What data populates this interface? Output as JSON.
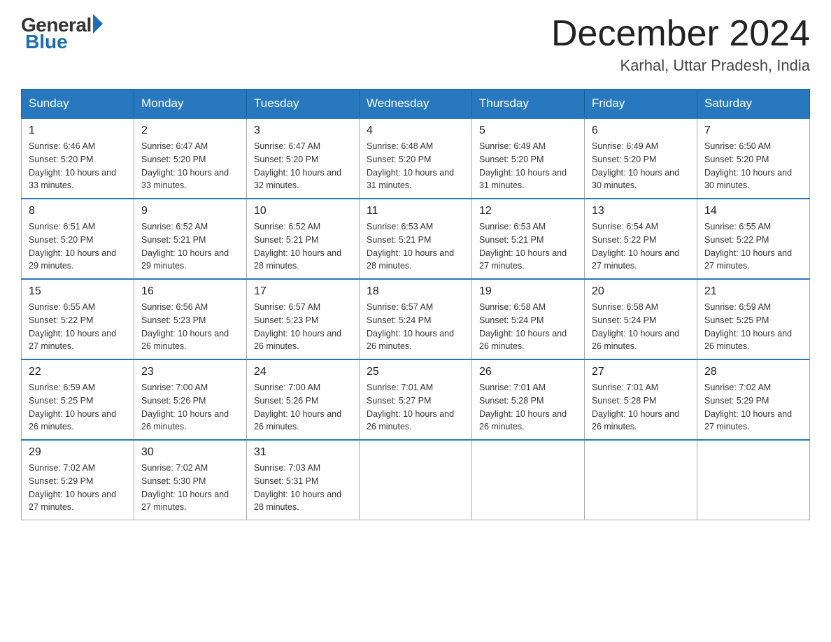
{
  "header": {
    "logo_general": "General",
    "logo_blue": "Blue",
    "logo_tagline": "Blue",
    "month_title": "December 2024",
    "location": "Karhal, Uttar Pradesh, India"
  },
  "days_of_week": [
    "Sunday",
    "Monday",
    "Tuesday",
    "Wednesday",
    "Thursday",
    "Friday",
    "Saturday"
  ],
  "weeks": [
    [
      {
        "day": "1",
        "sunrise": "6:46 AM",
        "sunset": "5:20 PM",
        "daylight": "10 hours and 33 minutes."
      },
      {
        "day": "2",
        "sunrise": "6:47 AM",
        "sunset": "5:20 PM",
        "daylight": "10 hours and 33 minutes."
      },
      {
        "day": "3",
        "sunrise": "6:47 AM",
        "sunset": "5:20 PM",
        "daylight": "10 hours and 32 minutes."
      },
      {
        "day": "4",
        "sunrise": "6:48 AM",
        "sunset": "5:20 PM",
        "daylight": "10 hours and 31 minutes."
      },
      {
        "day": "5",
        "sunrise": "6:49 AM",
        "sunset": "5:20 PM",
        "daylight": "10 hours and 31 minutes."
      },
      {
        "day": "6",
        "sunrise": "6:49 AM",
        "sunset": "5:20 PM",
        "daylight": "10 hours and 30 minutes."
      },
      {
        "day": "7",
        "sunrise": "6:50 AM",
        "sunset": "5:20 PM",
        "daylight": "10 hours and 30 minutes."
      }
    ],
    [
      {
        "day": "8",
        "sunrise": "6:51 AM",
        "sunset": "5:20 PM",
        "daylight": "10 hours and 29 minutes."
      },
      {
        "day": "9",
        "sunrise": "6:52 AM",
        "sunset": "5:21 PM",
        "daylight": "10 hours and 29 minutes."
      },
      {
        "day": "10",
        "sunrise": "6:52 AM",
        "sunset": "5:21 PM",
        "daylight": "10 hours and 28 minutes."
      },
      {
        "day": "11",
        "sunrise": "6:53 AM",
        "sunset": "5:21 PM",
        "daylight": "10 hours and 28 minutes."
      },
      {
        "day": "12",
        "sunrise": "6:53 AM",
        "sunset": "5:21 PM",
        "daylight": "10 hours and 27 minutes."
      },
      {
        "day": "13",
        "sunrise": "6:54 AM",
        "sunset": "5:22 PM",
        "daylight": "10 hours and 27 minutes."
      },
      {
        "day": "14",
        "sunrise": "6:55 AM",
        "sunset": "5:22 PM",
        "daylight": "10 hours and 27 minutes."
      }
    ],
    [
      {
        "day": "15",
        "sunrise": "6:55 AM",
        "sunset": "5:22 PM",
        "daylight": "10 hours and 27 minutes."
      },
      {
        "day": "16",
        "sunrise": "6:56 AM",
        "sunset": "5:23 PM",
        "daylight": "10 hours and 26 minutes."
      },
      {
        "day": "17",
        "sunrise": "6:57 AM",
        "sunset": "5:23 PM",
        "daylight": "10 hours and 26 minutes."
      },
      {
        "day": "18",
        "sunrise": "6:57 AM",
        "sunset": "5:24 PM",
        "daylight": "10 hours and 26 minutes."
      },
      {
        "day": "19",
        "sunrise": "6:58 AM",
        "sunset": "5:24 PM",
        "daylight": "10 hours and 26 minutes."
      },
      {
        "day": "20",
        "sunrise": "6:58 AM",
        "sunset": "5:24 PM",
        "daylight": "10 hours and 26 minutes."
      },
      {
        "day": "21",
        "sunrise": "6:59 AM",
        "sunset": "5:25 PM",
        "daylight": "10 hours and 26 minutes."
      }
    ],
    [
      {
        "day": "22",
        "sunrise": "6:59 AM",
        "sunset": "5:25 PM",
        "daylight": "10 hours and 26 minutes."
      },
      {
        "day": "23",
        "sunrise": "7:00 AM",
        "sunset": "5:26 PM",
        "daylight": "10 hours and 26 minutes."
      },
      {
        "day": "24",
        "sunrise": "7:00 AM",
        "sunset": "5:26 PM",
        "daylight": "10 hours and 26 minutes."
      },
      {
        "day": "25",
        "sunrise": "7:01 AM",
        "sunset": "5:27 PM",
        "daylight": "10 hours and 26 minutes."
      },
      {
        "day": "26",
        "sunrise": "7:01 AM",
        "sunset": "5:28 PM",
        "daylight": "10 hours and 26 minutes."
      },
      {
        "day": "27",
        "sunrise": "7:01 AM",
        "sunset": "5:28 PM",
        "daylight": "10 hours and 26 minutes."
      },
      {
        "day": "28",
        "sunrise": "7:02 AM",
        "sunset": "5:29 PM",
        "daylight": "10 hours and 27 minutes."
      }
    ],
    [
      {
        "day": "29",
        "sunrise": "7:02 AM",
        "sunset": "5:29 PM",
        "daylight": "10 hours and 27 minutes."
      },
      {
        "day": "30",
        "sunrise": "7:02 AM",
        "sunset": "5:30 PM",
        "daylight": "10 hours and 27 minutes."
      },
      {
        "day": "31",
        "sunrise": "7:03 AM",
        "sunset": "5:31 PM",
        "daylight": "10 hours and 28 minutes."
      },
      null,
      null,
      null,
      null
    ]
  ]
}
